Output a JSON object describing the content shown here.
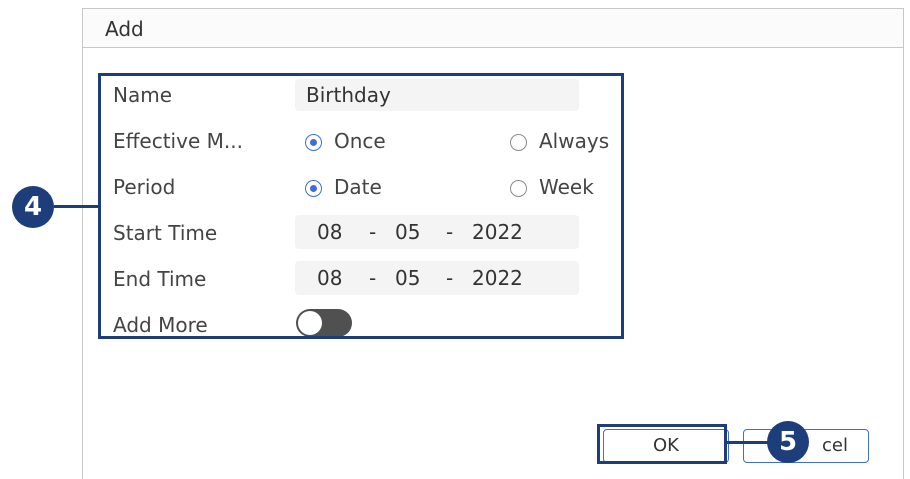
{
  "dialog": {
    "title": "Add",
    "form": {
      "name": {
        "label": "Name",
        "value": "Birthday"
      },
      "effective_mode": {
        "label": "Effective M...",
        "options": [
          {
            "label": "Once",
            "selected": true
          },
          {
            "label": "Always",
            "selected": false
          }
        ]
      },
      "period": {
        "label": "Period",
        "options": [
          {
            "label": "Date",
            "selected": true
          },
          {
            "label": "Week",
            "selected": false
          }
        ]
      },
      "start_time": {
        "label": "Start Time",
        "month": "08",
        "day": "05",
        "year": "2022",
        "sep": "-"
      },
      "end_time": {
        "label": "End Time",
        "month": "08",
        "day": "05",
        "year": "2022",
        "sep": "-"
      },
      "add_more": {
        "label": "Add More",
        "enabled": false
      }
    },
    "buttons": {
      "ok": "OK",
      "cancel": "cel"
    }
  },
  "callouts": {
    "form": "4",
    "ok": "5"
  },
  "colors": {
    "accent": "#3f6fd1",
    "callout": "#1e3d7b",
    "toggle_off": "#505050",
    "field_bg": "#f4f4f4"
  }
}
